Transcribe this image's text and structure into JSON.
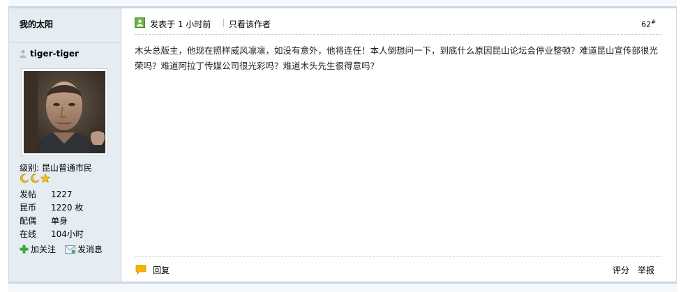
{
  "sidebar": {
    "author_title": "我的太阳",
    "username": "tiger-tiger",
    "level_text": "级别: 昆山普通市民",
    "stats": [
      {
        "key": "发帖",
        "value": "1227"
      },
      {
        "key": "昆币",
        "value": "1220 枚"
      },
      {
        "key": "配偶",
        "value": "单身"
      },
      {
        "key": "在线",
        "value": "104小时"
      }
    ],
    "follow_label": "加关注",
    "message_label": "发消息"
  },
  "post": {
    "time_text": "发表于 1 小时前",
    "only_author_label": "只看该作者",
    "floor_number": "62",
    "floor_mark": "#",
    "body": "木头总版主，他现在照样威风凛凛，如没有意外，他将连任！本人倒想问一下，到底什么原因昆山论坛会停业整顿？难道昆山宣传部很光荣吗？难道阿拉丁传媒公司很光彩吗？难道木头先生很得意吗？",
    "reply_label": "回复",
    "rate_label": "评分",
    "report_label": "举报"
  },
  "colors": {
    "sidebar_bg": "#e5edf2",
    "border": "#c2d5e3"
  },
  "icons": [
    "user-icon",
    "avatar-photo",
    "moon-medal-icon",
    "star-medal-icon",
    "plus-icon",
    "mail-icon",
    "post-status-icon",
    "reply-bubble-icon"
  ]
}
